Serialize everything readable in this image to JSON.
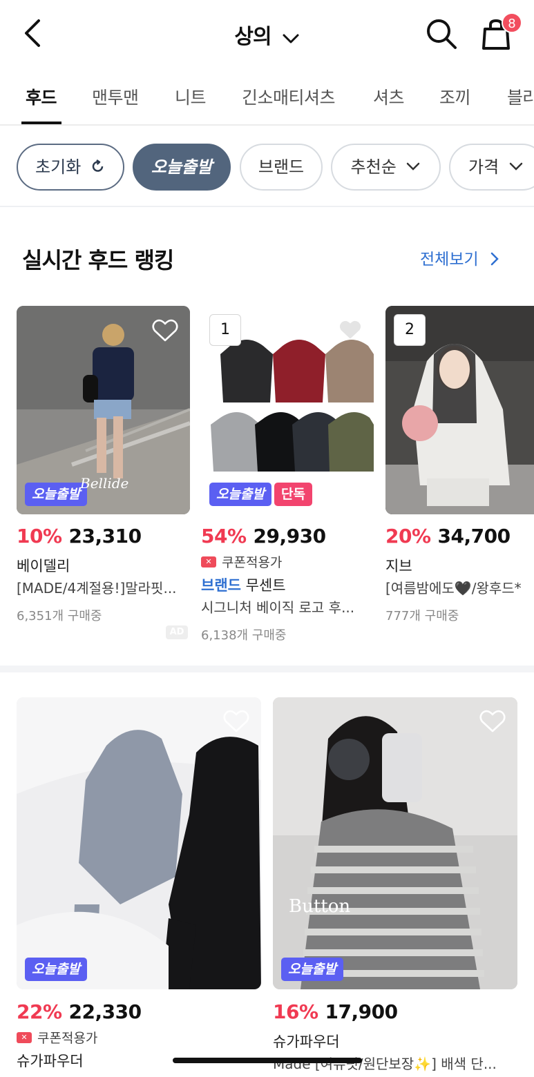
{
  "header": {
    "title": "상의",
    "cart_count": "8"
  },
  "tabs": [
    {
      "label": "후드"
    },
    {
      "label": "맨투맨"
    },
    {
      "label": "니트"
    },
    {
      "label": "긴소매티셔츠"
    },
    {
      "label": "셔츠"
    },
    {
      "label": "조끼"
    },
    {
      "label": "블라"
    }
  ],
  "filters": {
    "reset": "초기화",
    "today_ship": "오늘출발",
    "brand": "브랜드",
    "sort": "추천순",
    "price": "가격"
  },
  "section": {
    "title": "실시간 후드 랭킹",
    "see_all": "전체보기"
  },
  "ranking": [
    {
      "discount": "10%",
      "price": "23,310",
      "brand": "베이델리",
      "name": "[MADE/4계절용!]말라핏...",
      "sold": "6,351개 구매중",
      "badge": "오늘출발",
      "ad": "AD",
      "watermark": "Bellide"
    },
    {
      "rank": "1",
      "discount": "54%",
      "price": "29,930",
      "coupon": "쿠폰적용가",
      "brand_prefix": "브랜드",
      "brand": "무센트",
      "name": "시그니처 베이직 로고 후...",
      "sold": "6,138개 구매중",
      "badge": "오늘출발",
      "badge2": "단독"
    },
    {
      "rank": "2",
      "discount": "20%",
      "price": "34,700",
      "brand": "지브",
      "name": "[여름밤에도🖤/왕후드*",
      "sold": "777개 구매중"
    }
  ],
  "grid": [
    {
      "discount": "22%",
      "price": "22,330",
      "coupon": "쿠폰적용가",
      "brand": "슈가파우더",
      "badge": "오늘출발"
    },
    {
      "discount": "16%",
      "price": "17,900",
      "brand": "슈가파우더",
      "name": "Made [여유핏/원단보장✨] 배색 단...",
      "badge": "오늘출발",
      "watermark": "Button"
    }
  ],
  "colors": {
    "discount": "#f03a52",
    "today_badge": "#5b5ff2",
    "exclusive_badge": "#f2446e",
    "link_blue": "#2e6fd1",
    "chip_dark": "#52657d",
    "cart_badge": "#f24e5e"
  },
  "icons": [
    "back-arrow-icon",
    "chevron-down-icon",
    "search-icon",
    "cart-icon",
    "refresh-icon",
    "heart-icon",
    "chevron-right-icon",
    "coupon-icon"
  ]
}
